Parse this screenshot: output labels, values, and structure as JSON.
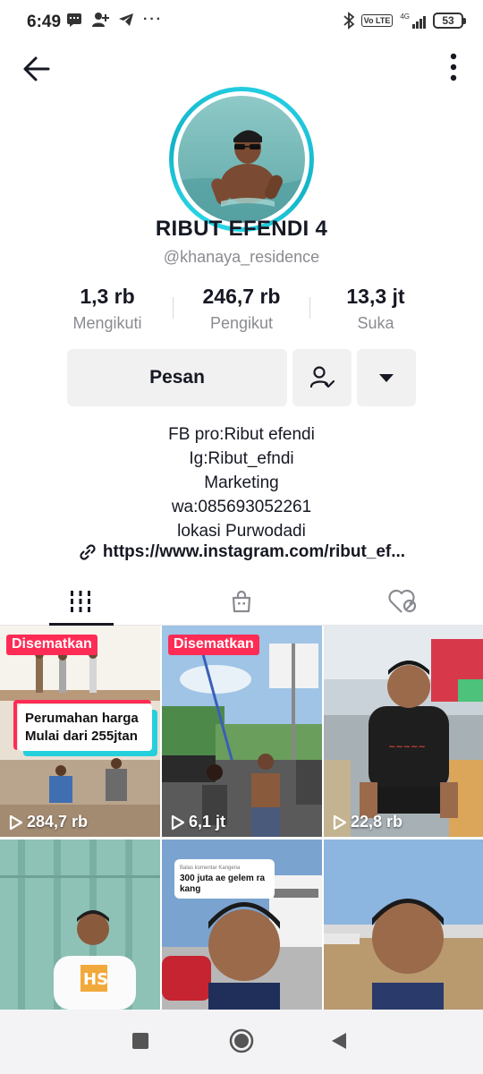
{
  "status_bar": {
    "time": "6:49",
    "network": "4G",
    "volte": "Vo LTE",
    "battery": "53"
  },
  "header": {
    "back_icon": "arrow-left-icon",
    "more_icon": "vertical-dots-icon"
  },
  "profile": {
    "name": "RIBUT EFENDI 4",
    "username": "@khanaya_residence"
  },
  "stats": [
    {
      "value": "1,3 rb",
      "label": "Mengikuti"
    },
    {
      "value": "246,7 rb",
      "label": "Pengikut"
    },
    {
      "value": "13,3 jt",
      "label": "Suka"
    }
  ],
  "actions": {
    "message_label": "Pesan",
    "friend_icon": "user-check-icon",
    "dropdown_icon": "caret-down-icon"
  },
  "bio": {
    "lines": [
      "FB pro:Ribut efendi",
      "Ig:Ribut_efndi",
      "Marketing",
      "wa:085693052261",
      "lokasi Purwodadi"
    ],
    "link": "https://www.instagram.com/ribut_ef..."
  },
  "tabs": [
    {
      "icon": "grid-icon",
      "active": true
    },
    {
      "icon": "shopping-bag-icon",
      "active": false
    },
    {
      "icon": "liked-heart-icon",
      "active": false
    }
  ],
  "videos": [
    {
      "pinned": "Disematkan",
      "views": "284,7 rb",
      "overlay_text": "Perumahan harga Mulai dari 255jtan"
    },
    {
      "pinned": "Disematkan",
      "views": "6,1 jt"
    },
    {
      "views": "22,8 rb"
    },
    {},
    {
      "comment_title": "Balas komentar Kangena",
      "comment_text": "300 juta ae gelem ra kang"
    },
    {}
  ],
  "nav_bar": {
    "recents_icon": "square-icon",
    "home_icon": "circle-icon",
    "back_icon": "triangle-back-icon"
  },
  "colors": {
    "accent": "#fe2c55",
    "avatar_ring": "#20c5da",
    "text_primary": "#161823",
    "text_secondary": "#8a8b91"
  }
}
